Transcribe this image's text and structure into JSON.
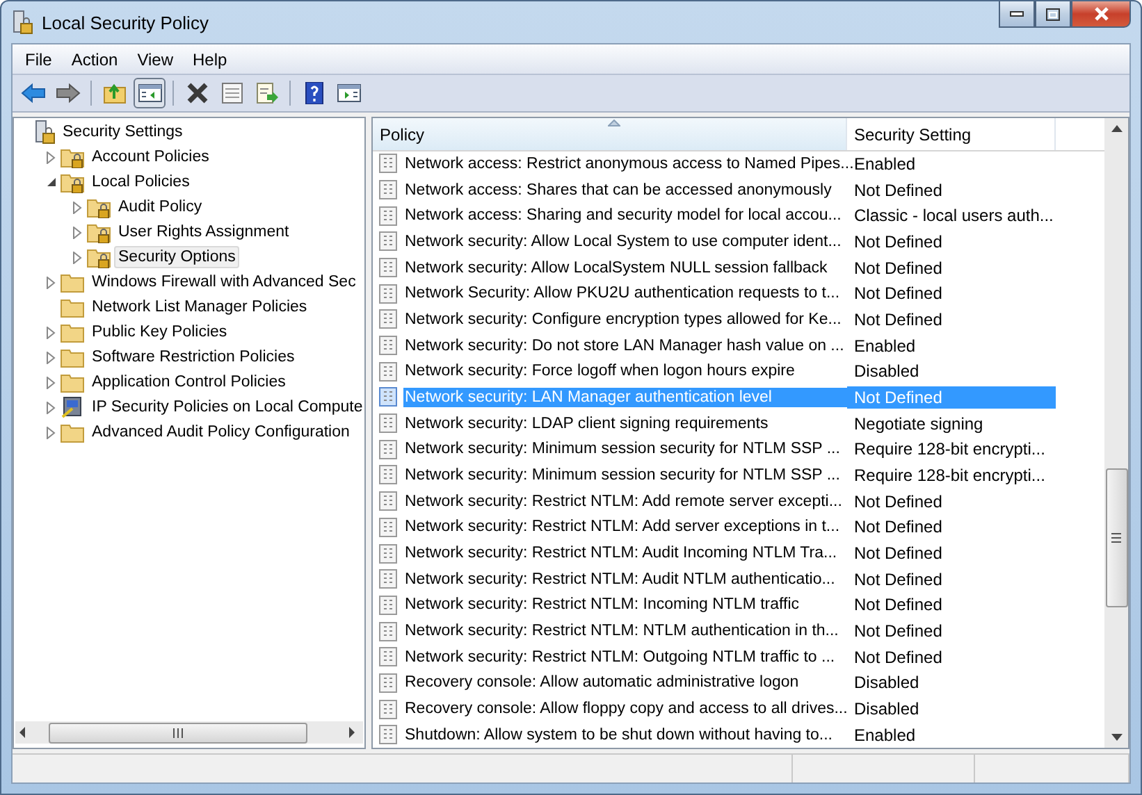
{
  "window": {
    "title": "Local Security Policy"
  },
  "menu": [
    "File",
    "Action",
    "View",
    "Help"
  ],
  "toolbar": [
    {
      "kind": "back",
      "pressed": false
    },
    {
      "kind": "forward",
      "pressed": false
    },
    {
      "kind": "up",
      "pressed": false
    },
    {
      "kind": "tree",
      "pressed": true
    },
    {
      "kind": "delete",
      "pressed": false
    },
    {
      "kind": "properties",
      "pressed": false
    },
    {
      "kind": "export",
      "pressed": false
    },
    {
      "kind": "help",
      "pressed": false
    },
    {
      "kind": "pane",
      "pressed": false
    }
  ],
  "tree": [
    {
      "label": "Security Settings",
      "kind": "root",
      "selected": false,
      "children": [
        {
          "label": "Account Policies",
          "kind": "lock-folder",
          "expanded": false,
          "selected": false
        },
        {
          "label": "Local Policies",
          "kind": "lock-folder",
          "expanded": true,
          "selected": false,
          "children": [
            {
              "label": "Audit Policy",
              "kind": "lock-folder",
              "expanded": false,
              "selected": false
            },
            {
              "label": "User Rights Assignment",
              "kind": "lock-folder",
              "expanded": false,
              "selected": false
            },
            {
              "label": "Security Options",
              "kind": "lock-folder",
              "expanded": false,
              "selected": true
            }
          ]
        },
        {
          "label": "Windows Firewall with Advanced Sec",
          "kind": "folder",
          "expanded": false,
          "selected": false
        },
        {
          "label": "Network List Manager Policies",
          "kind": "folder",
          "selected": false
        },
        {
          "label": "Public Key Policies",
          "kind": "folder",
          "expanded": false,
          "selected": false
        },
        {
          "label": "Software Restriction Policies",
          "kind": "folder",
          "expanded": false,
          "selected": false
        },
        {
          "label": "Application Control Policies",
          "kind": "folder",
          "expanded": false,
          "selected": false
        },
        {
          "label": "IP Security Policies on Local Compute",
          "kind": "ip-security",
          "expanded": false,
          "selected": false
        },
        {
          "label": "Advanced Audit Policy Configuration",
          "kind": "folder",
          "expanded": false,
          "selected": false
        }
      ]
    }
  ],
  "table": {
    "columns": [
      "Policy",
      "Security Setting"
    ],
    "rows": [
      {
        "policy": "Network access: Restrict anonymous access to Named Pipes...",
        "setting": "Enabled",
        "selected": false
      },
      {
        "policy": "Network access: Shares that can be accessed anonymously",
        "setting": "Not Defined",
        "selected": false
      },
      {
        "policy": "Network access: Sharing and security model for local accou...",
        "setting": "Classic - local users auth...",
        "selected": false
      },
      {
        "policy": "Network security: Allow Local System to use computer ident...",
        "setting": "Not Defined",
        "selected": false
      },
      {
        "policy": "Network security: Allow LocalSystem NULL session fallback",
        "setting": "Not Defined",
        "selected": false
      },
      {
        "policy": "Network Security: Allow PKU2U authentication requests to t...",
        "setting": "Not Defined",
        "selected": false
      },
      {
        "policy": "Network security: Configure encryption types allowed for Ke...",
        "setting": "Not Defined",
        "selected": false
      },
      {
        "policy": "Network security: Do not store LAN Manager hash value on ...",
        "setting": "Enabled",
        "selected": false
      },
      {
        "policy": "Network security: Force logoff when logon hours expire",
        "setting": "Disabled",
        "selected": false
      },
      {
        "policy": "Network security: LAN Manager authentication level",
        "setting": "Not Defined",
        "selected": true
      },
      {
        "policy": "Network security: LDAP client signing requirements",
        "setting": "Negotiate signing",
        "selected": false
      },
      {
        "policy": "Network security: Minimum session security for NTLM SSP ...",
        "setting": "Require 128-bit encrypti...",
        "selected": false
      },
      {
        "policy": "Network security: Minimum session security for NTLM SSP ...",
        "setting": "Require 128-bit encrypti...",
        "selected": false
      },
      {
        "policy": "Network security: Restrict NTLM: Add remote server excepti...",
        "setting": "Not Defined",
        "selected": false
      },
      {
        "policy": "Network security: Restrict NTLM: Add server exceptions in t...",
        "setting": "Not Defined",
        "selected": false
      },
      {
        "policy": "Network security: Restrict NTLM: Audit Incoming NTLM Tra...",
        "setting": "Not Defined",
        "selected": false
      },
      {
        "policy": "Network security: Restrict NTLM: Audit NTLM authenticatio...",
        "setting": "Not Defined",
        "selected": false
      },
      {
        "policy": "Network security: Restrict NTLM: Incoming NTLM traffic",
        "setting": "Not Defined",
        "selected": false
      },
      {
        "policy": "Network security: Restrict NTLM: NTLM authentication in th...",
        "setting": "Not Defined",
        "selected": false
      },
      {
        "policy": "Network security: Restrict NTLM: Outgoing NTLM traffic to ...",
        "setting": "Not Defined",
        "selected": false
      },
      {
        "policy": "Recovery console: Allow automatic administrative logon",
        "setting": "Disabled",
        "selected": false
      },
      {
        "policy": "Recovery console: Allow floppy copy and access to all drives...",
        "setting": "Disabled",
        "selected": false
      },
      {
        "policy": "Shutdown: Allow system to be shut down without having to...",
        "setting": "Enabled",
        "selected": false
      }
    ]
  }
}
